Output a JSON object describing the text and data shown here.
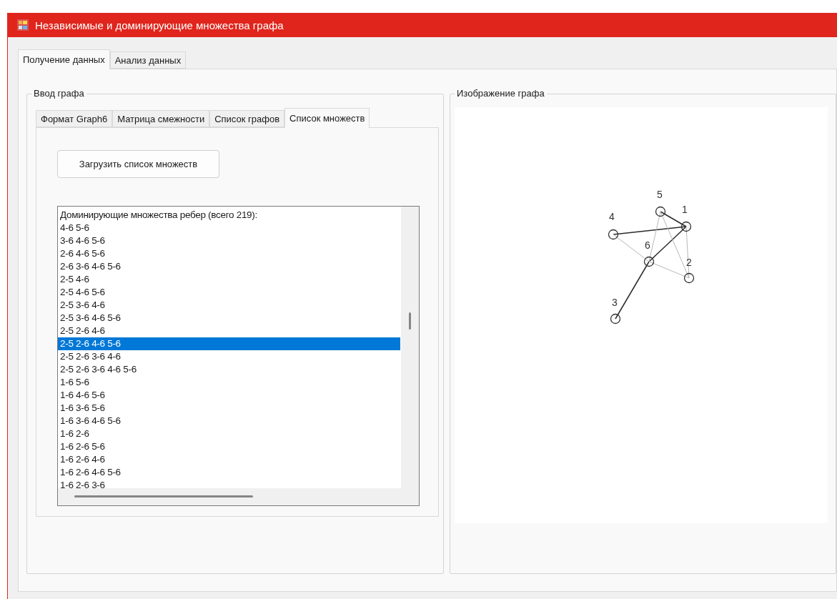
{
  "window": {
    "title": "Независимые и доминирующие множества графа"
  },
  "tabs": [
    {
      "label": "Получение данных",
      "selected": true
    },
    {
      "label": "Анализ данных",
      "selected": false
    }
  ],
  "input_group": {
    "title": "Ввод графа",
    "tabs": [
      {
        "label": "Формат Graph6",
        "selected": false
      },
      {
        "label": "Матрица смежности",
        "selected": false
      },
      {
        "label": "Список графов",
        "selected": false
      },
      {
        "label": "Список множеств",
        "selected": true
      }
    ],
    "load_button": "Загрузить список множеств",
    "list": [
      {
        "text": "Доминирующие множества ребер (всего 219):",
        "selected": false
      },
      {
        "text": "4-6 5-6",
        "selected": false
      },
      {
        "text": "3-6 4-6 5-6",
        "selected": false
      },
      {
        "text": "2-6 4-6 5-6",
        "selected": false
      },
      {
        "text": "2-6 3-6 4-6 5-6",
        "selected": false
      },
      {
        "text": "2-5 4-6",
        "selected": false
      },
      {
        "text": "2-5 4-6 5-6",
        "selected": false
      },
      {
        "text": "2-5 3-6 4-6",
        "selected": false
      },
      {
        "text": "2-5 3-6 4-6 5-6",
        "selected": false
      },
      {
        "text": "2-5 2-6 4-6",
        "selected": false
      },
      {
        "text": "2-5 2-6 4-6 5-6",
        "selected": true
      },
      {
        "text": "2-5 2-6 3-6 4-6",
        "selected": false
      },
      {
        "text": "2-5 2-6 3-6 4-6 5-6",
        "selected": false
      },
      {
        "text": "1-6 5-6",
        "selected": false
      },
      {
        "text": "1-6 4-6 5-6",
        "selected": false
      },
      {
        "text": "1-6 3-6 5-6",
        "selected": false
      },
      {
        "text": "1-6 3-6 4-6 5-6",
        "selected": false
      },
      {
        "text": "1-6 2-6",
        "selected": false
      },
      {
        "text": "1-6 2-6 5-6",
        "selected": false
      },
      {
        "text": "1-6 2-6 4-6",
        "selected": false
      },
      {
        "text": "1-6 2-6 4-6 5-6",
        "selected": false
      },
      {
        "text": "1-6 2-6 3-6",
        "selected": false
      }
    ]
  },
  "graph_group": {
    "title": "Изображение графа",
    "nodes": [
      {
        "label": "1"
      },
      {
        "label": "2"
      },
      {
        "label": "3"
      },
      {
        "label": "4"
      },
      {
        "label": "5"
      },
      {
        "label": "6"
      }
    ],
    "edges": [
      {
        "highlighted": true
      },
      {
        "highlighted": true
      },
      {
        "highlighted": true
      },
      {
        "highlighted": true
      },
      {
        "highlighted": false
      },
      {
        "highlighted": false
      },
      {
        "highlighted": false
      },
      {
        "highlighted": false
      },
      {
        "highlighted": false
      }
    ]
  }
}
